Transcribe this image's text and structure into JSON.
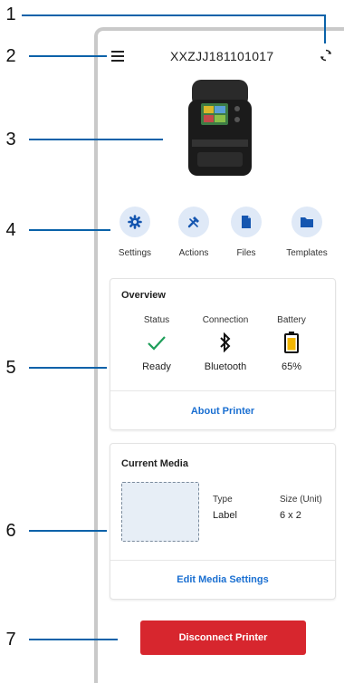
{
  "callouts": [
    "1",
    "2",
    "3",
    "4",
    "5",
    "6",
    "7"
  ],
  "header": {
    "title": "XXZJJ181101017",
    "menu_icon": "hamburger-menu-icon",
    "refresh_icon": "refresh-icon"
  },
  "actions": [
    {
      "label": "Settings",
      "icon": "gear-icon"
    },
    {
      "label": "Actions",
      "icon": "tools-icon"
    },
    {
      "label": "Files",
      "icon": "file-icon"
    },
    {
      "label": "Templates",
      "icon": "folder-icon"
    }
  ],
  "overview": {
    "title": "Overview",
    "status": {
      "header": "Status",
      "value": "Ready",
      "icon": "checkmark-icon"
    },
    "connection": {
      "header": "Connection",
      "value": "Bluetooth",
      "icon": "bluetooth-icon"
    },
    "battery": {
      "header": "Battery",
      "value": "65%",
      "icon": "battery-icon"
    },
    "link": "About Printer"
  },
  "media": {
    "title": "Current Media",
    "type_header": "Type",
    "type_value": "Label",
    "size_header": "Size (Unit)",
    "size_value": "6 x 2",
    "link": "Edit Media Settings"
  },
  "disconnect_label": "Disconnect Printer",
  "colors": {
    "accent": "#1a6fd1",
    "callout_line": "#0a62a9",
    "danger": "#d7262e",
    "icon_bg": "#dfe9f7",
    "check": "#1e9e5a",
    "battery": "#f2b600"
  }
}
